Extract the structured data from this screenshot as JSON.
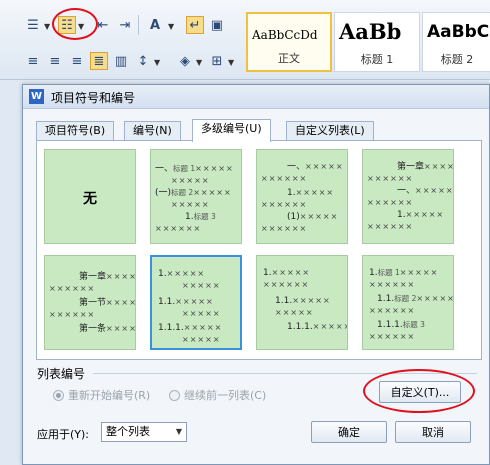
{
  "ribbon": {
    "styles": [
      {
        "sample": "AaBbCcDd",
        "name": "正文"
      },
      {
        "sample": "AaBb",
        "name": "标题 1"
      },
      {
        "sample": "AaBbC",
        "name": "标题 2"
      }
    ]
  },
  "dialog": {
    "title": "项目符号和编号",
    "tabs": [
      {
        "label": "项目符号(B)"
      },
      {
        "label": "编号(N)"
      },
      {
        "label": "多级编号(U)"
      },
      {
        "label": "自定义列表(L)"
      }
    ],
    "cells": {
      "none": "无",
      "c2": {
        "l1": "一、",
        "t1": "标题 1",
        "l2": "(一)",
        "t2": "标题 2",
        "l3": "1.",
        "t3": "标题 3"
      },
      "c3": {
        "l1": "一、",
        "l2": "1.",
        "l3": "(1)"
      },
      "c4": {
        "l1": "第一章",
        "l2": "一、",
        "l3": "1."
      },
      "c5": {
        "l1": "第一章",
        "l2": "第一节",
        "l3": "第一条"
      },
      "c6": {
        "l1": "1.",
        "l2": "1.1.",
        "l3": "1.1.1."
      },
      "c7": {
        "l1": "1.",
        "l2": "1.1.",
        "l3": "1.1.1."
      },
      "c8": {
        "l1": "1.",
        "t1": "标题 1",
        "l2": "1.1.",
        "t2": "标题 2",
        "l3": "1.1.1.",
        "t3": "标题 3"
      },
      "xmarks": "×××××",
      "xmarks_long": "××××××"
    },
    "list_numbering": {
      "label": "列表编号",
      "restart": "重新开始编号(R)",
      "continue": "继续前一列表(C)",
      "customize": "自定义(T)..."
    },
    "apply_to": {
      "label": "应用于(Y):",
      "value": "整个列表"
    },
    "ok": "确定",
    "cancel": "取消"
  }
}
